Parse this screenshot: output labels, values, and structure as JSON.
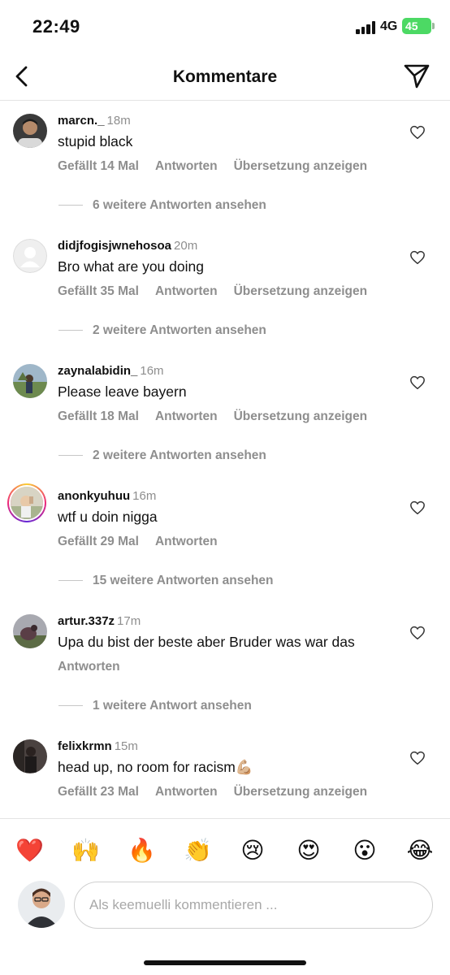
{
  "status_bar": {
    "time": "22:49",
    "network": "4G",
    "battery": "45"
  },
  "header": {
    "title": "Kommentare",
    "back_icon": "chevron-left-icon",
    "send_icon": "paper-plane-icon"
  },
  "comments": [
    {
      "username": "marcn._",
      "time": "18m",
      "text": "stupid black",
      "likes": "Gefällt 14 Mal",
      "reply": "Antworten",
      "translate": "Übersetzung anzeigen",
      "more_replies": "6 weitere Antworten ansehen"
    },
    {
      "username": "didjfogisjwnehosoa",
      "time": "20m",
      "text": "Bro what are you doing",
      "likes": "Gefällt 35 Mal",
      "reply": "Antworten",
      "translate": "Übersetzung anzeigen",
      "more_replies": "2 weitere Antworten ansehen"
    },
    {
      "username": "zaynalabidin_",
      "time": "16m",
      "text": "Please leave bayern",
      "likes": "Gefällt 18 Mal",
      "reply": "Antworten",
      "translate": "Übersetzung anzeigen",
      "more_replies": "2 weitere Antworten ansehen"
    },
    {
      "username": "anonkyuhuu",
      "time": "16m",
      "text": "wtf u doin nigga",
      "likes": "Gefällt 29 Mal",
      "reply": "Antworten",
      "more_replies": "15 weitere Antworten ansehen"
    },
    {
      "username": "artur.337z",
      "time": "17m",
      "text": "Upa du bist der beste aber Bruder was war das",
      "reply": "Antworten",
      "more_replies": "1 weitere Antwort ansehen"
    },
    {
      "username": "felixkrmn",
      "time": "15m",
      "text": "head up, no room for racism💪🏼",
      "likes": "Gefällt 23 Mal",
      "reply": "Antworten",
      "translate": "Übersetzung anzeigen"
    }
  ],
  "emoji_bar": [
    "❤️",
    "🙌",
    "🔥",
    "👏",
    "😢",
    "😍",
    "😮",
    "😂"
  ],
  "composer": {
    "placeholder": "Als keemuelli kommentieren ..."
  },
  "colors": {
    "muted_text": "#8e8e8e",
    "battery": "#4cd964",
    "divider": "#e4e4e4"
  }
}
